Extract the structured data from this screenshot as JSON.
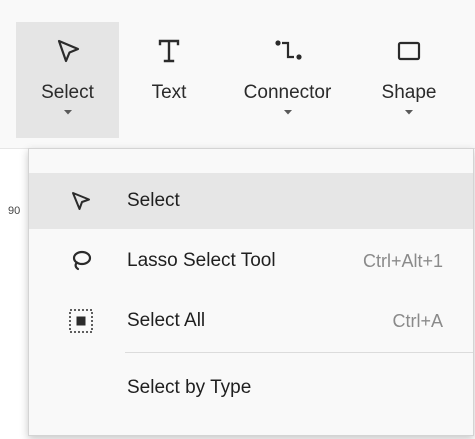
{
  "toolbar": {
    "buttons": [
      {
        "label": "Select",
        "icon": "pointer-arrow-icon",
        "active": true,
        "has_dropdown": true
      },
      {
        "label": "Text",
        "icon": "text-t-icon",
        "active": false,
        "has_dropdown": false
      },
      {
        "label": "Connector",
        "icon": "connector-icon",
        "active": false,
        "has_dropdown": true
      },
      {
        "label": "Shape",
        "icon": "square-shape-icon",
        "active": false,
        "has_dropdown": true
      }
    ]
  },
  "ruler": {
    "visible_number": "90"
  },
  "select_menu": {
    "items": [
      {
        "label": "Select",
        "shortcut": "",
        "icon": "pointer-arrow-icon",
        "highlighted": true
      },
      {
        "label": "Lasso Select Tool",
        "shortcut": "Ctrl+Alt+1",
        "icon": "lasso-icon",
        "highlighted": false
      },
      {
        "label": "Select All",
        "shortcut": "Ctrl+A",
        "icon": "select-all-icon",
        "highlighted": false
      },
      {
        "label": "Select by Type",
        "shortcut": "",
        "icon": "",
        "highlighted": false
      }
    ]
  },
  "colors": {
    "ribbon_bg": "#f9f9f9",
    "active_button_bg": "#e5e5e5",
    "menu_bg": "#f9f9f9",
    "menu_highlight": "#e6e6e6",
    "shortcut_text": "#8a8a8a"
  }
}
